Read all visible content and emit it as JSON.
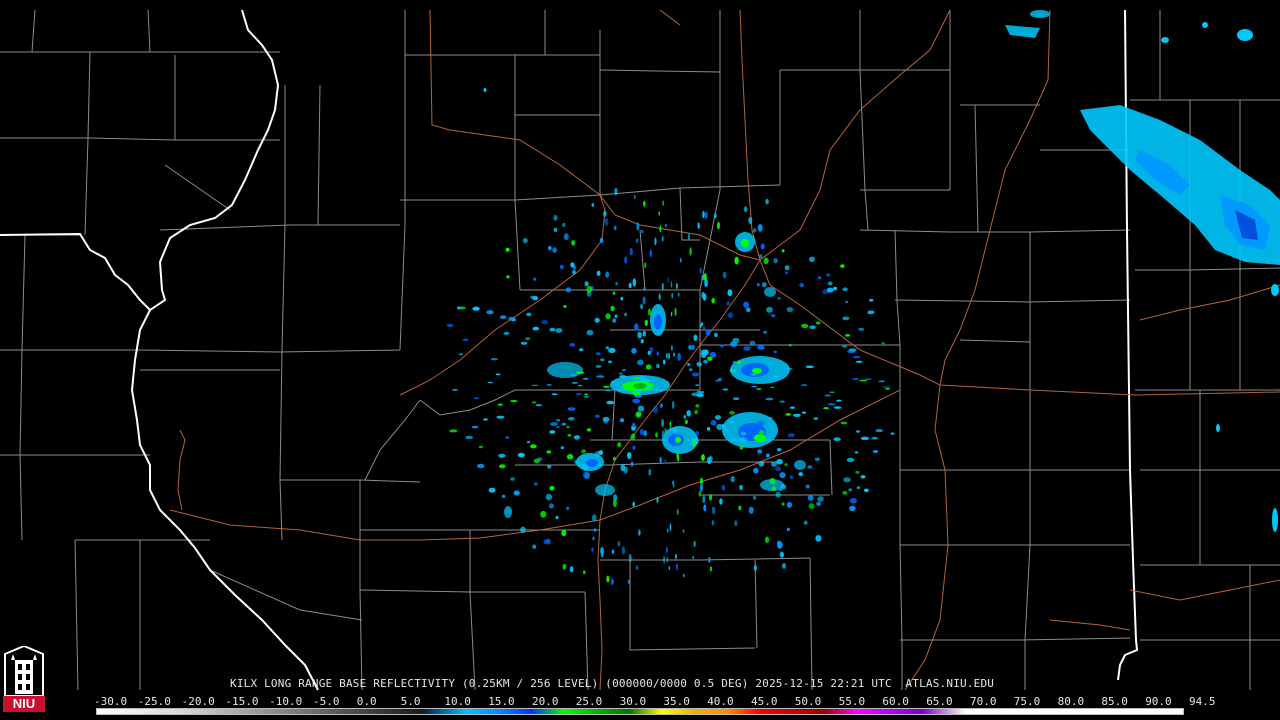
{
  "caption": {
    "text": "KILX LONG RANGE BASE REFLECTIVITY (0.25KM / 256 LEVEL) (000000/0000 0.5 DEG) 2025-12-15 22:21 UTC  ATLAS.NIU.EDU"
  },
  "logo": {
    "text": "NIU",
    "icon": "niu-tower-logo-icon"
  },
  "scale": {
    "labels": [
      "-30.0",
      "-25.0",
      "-20.0",
      "-15.0",
      "-10.0",
      "-5.0",
      "0.0",
      "5.0",
      "10.0",
      "15.0",
      "20.0",
      "25.0",
      "30.0",
      "35.0",
      "40.0",
      "45.0",
      "50.0",
      "55.0",
      "60.0",
      "65.0",
      "70.0",
      "75.0",
      "80.0",
      "85.0",
      "90.0",
      "94.5"
    ]
  },
  "colors": {
    "background": "#000000",
    "county_lines": "#8c8c8c",
    "state_lines": "#ffffff",
    "highways": "#b4643c",
    "light_echo": "#00c8ff",
    "medium_echo": "#0064ff",
    "strong_echo": "#00ff00"
  }
}
